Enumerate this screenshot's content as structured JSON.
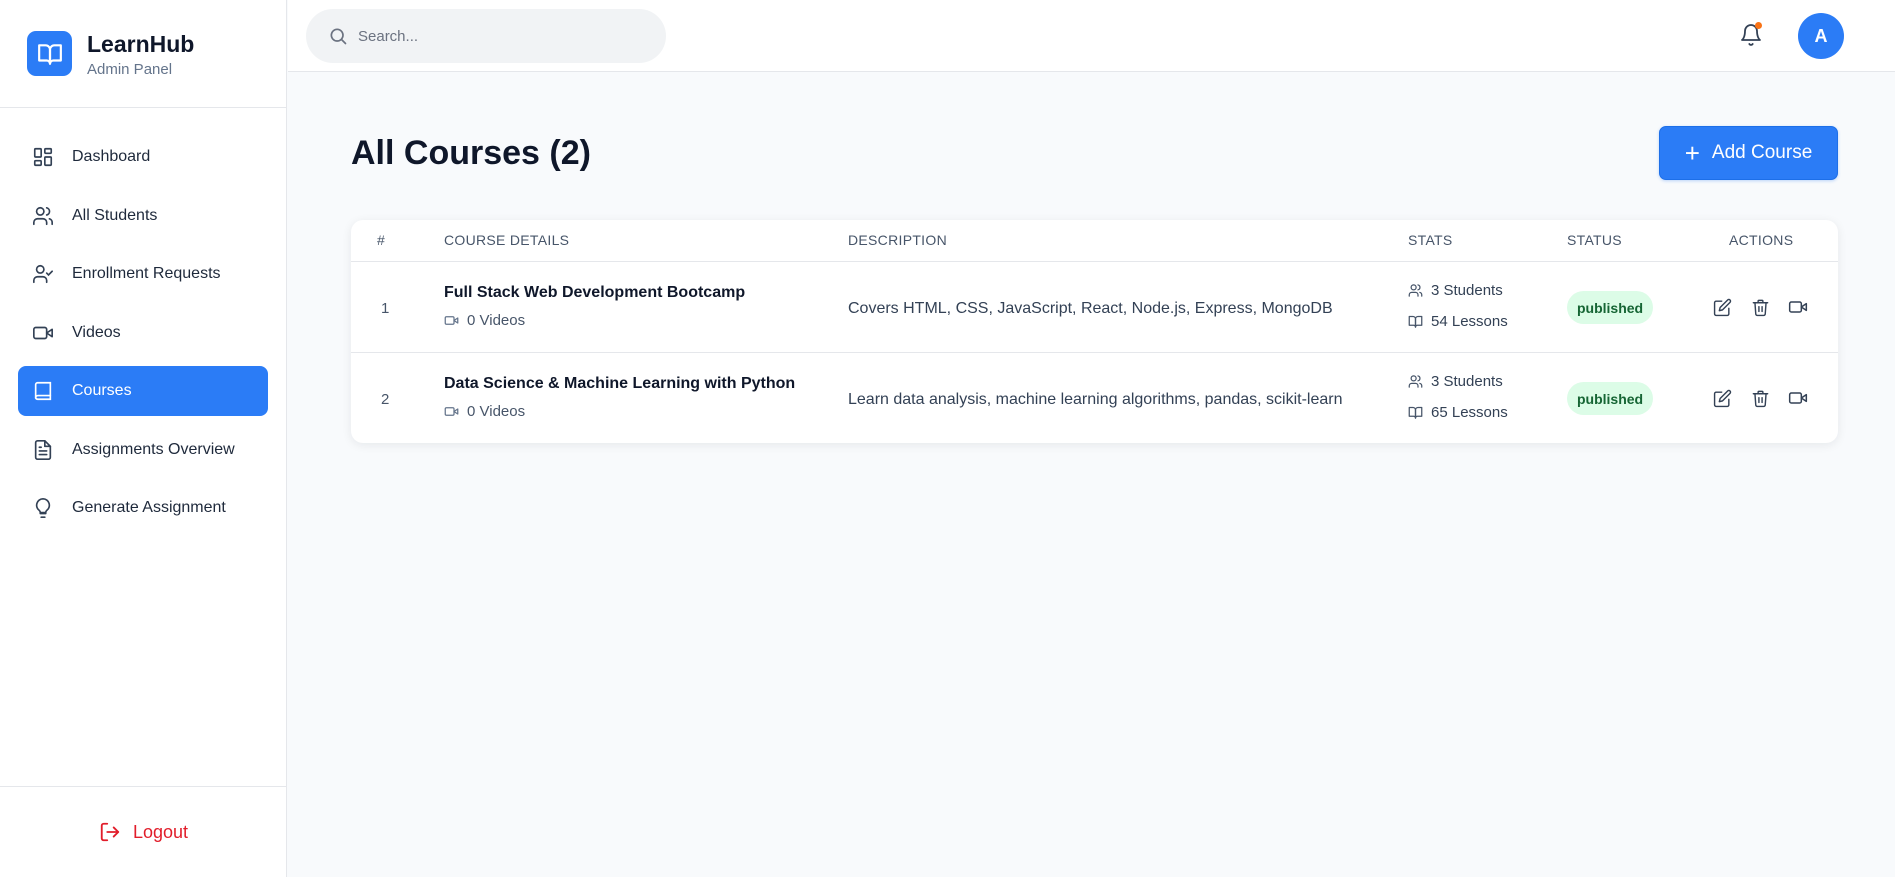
{
  "brand": {
    "title": "LearnHub",
    "subtitle": "Admin Panel"
  },
  "sidebar": {
    "items": [
      {
        "label": "Dashboard",
        "icon": "grid-icon"
      },
      {
        "label": "All Students",
        "icon": "users-icon"
      },
      {
        "label": "Enrollment Requests",
        "icon": "user-check-icon"
      },
      {
        "label": "Videos",
        "icon": "video-icon"
      },
      {
        "label": "Courses",
        "icon": "book-icon",
        "active": true
      },
      {
        "label": "Assignments Overview",
        "icon": "file-text-icon"
      },
      {
        "label": "Generate Assignment",
        "icon": "lightbulb-icon"
      }
    ],
    "logout_label": "Logout"
  },
  "topbar": {
    "search_placeholder": "Search...",
    "avatar_initial": "A"
  },
  "main": {
    "title": "All Courses (2)",
    "add_button_label": "Add Course",
    "table": {
      "headers": [
        "#",
        "COURSE DETAILS",
        "DESCRIPTION",
        "STATS",
        "STATUS",
        "ACTIONS"
      ],
      "rows": [
        {
          "num": "1",
          "title": "Full Stack Web Development Bootcamp",
          "videos": "0 Videos",
          "description": "Covers HTML, CSS, JavaScript, React, Node.js, Express, MongoDB",
          "students": "3 Students",
          "lessons": "54 Lessons",
          "status": "published"
        },
        {
          "num": "2",
          "title": "Data Science & Machine Learning with Python",
          "videos": "0 Videos",
          "description": "Learn data analysis, machine learning algorithms, pandas, scikit-learn",
          "students": "3 Students",
          "lessons": "65 Lessons",
          "status": "published"
        }
      ]
    }
  },
  "colors": {
    "accent": "#2b7cf6",
    "logout": "#e11d2a",
    "badge_bg": "#dcfce7",
    "badge_text": "#166534",
    "notification_dot": "#f97316"
  }
}
